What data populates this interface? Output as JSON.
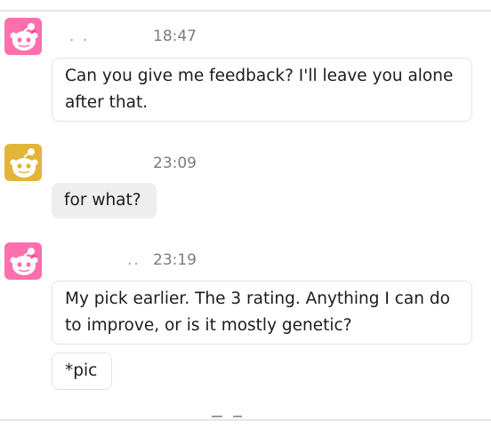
{
  "messages": [
    {
      "username": ". .",
      "time": "18:47",
      "avatar_color": "#ff6fae",
      "avatar_icon": "snoo-avatar-icon",
      "bubbles": [
        "Can you give me feedback? I'll leave you alone after that."
      ]
    },
    {
      "username": "",
      "time": "23:09",
      "avatar_color": "#e2b53a",
      "avatar_icon": "snoo-avatar-icon",
      "bubbles": [
        "for what?"
      ]
    },
    {
      "username": "..",
      "time": "23:19",
      "avatar_color": "#ff6fae",
      "avatar_icon": "snoo-avatar-icon",
      "bubbles": [
        "My pick earlier. The 3 rating. Anything I can do to improve, or is it mostly genetic?",
        "*pic"
      ]
    }
  ]
}
